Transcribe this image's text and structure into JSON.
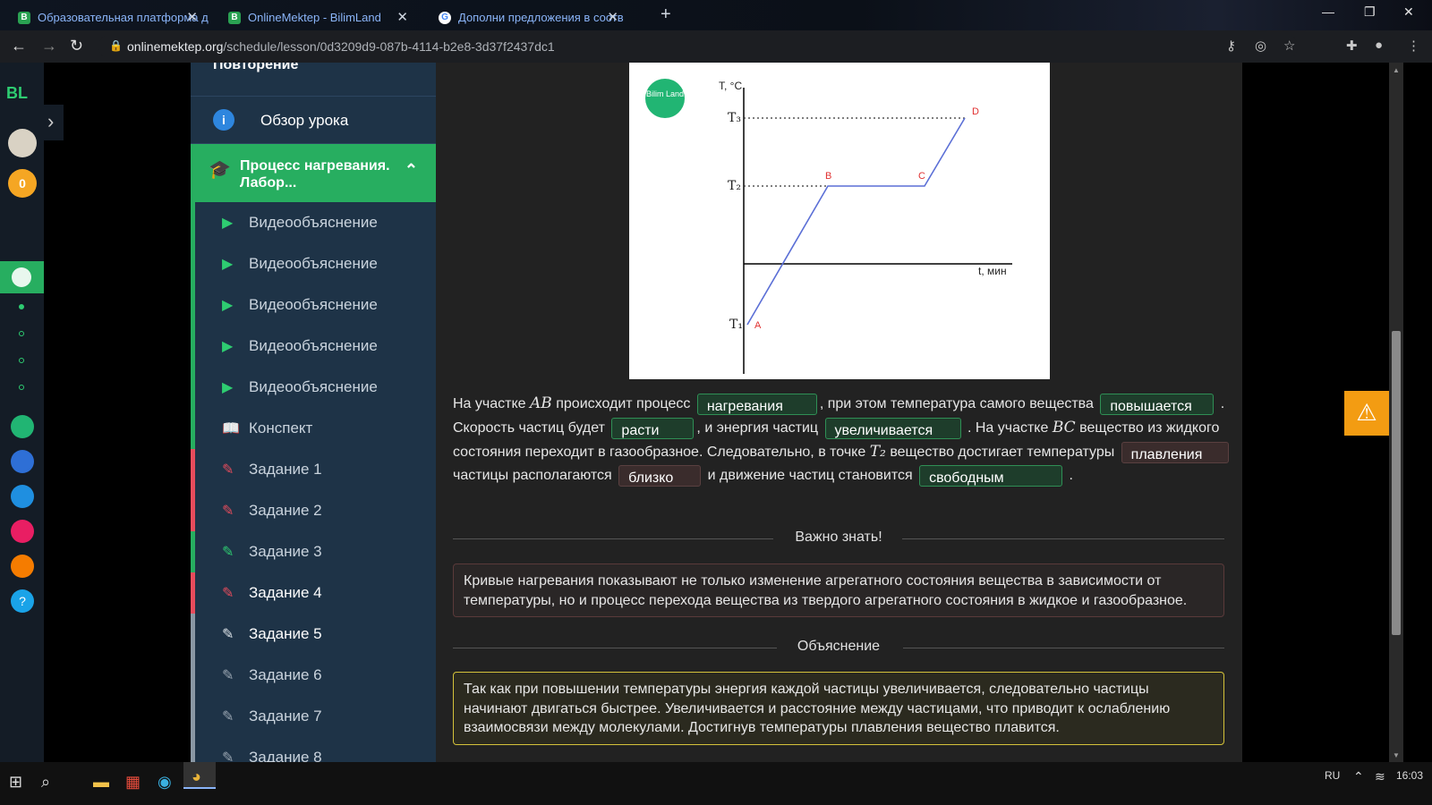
{
  "browser": {
    "tabs": [
      {
        "label": "Образовательная платформа д",
        "favicon": "B"
      },
      {
        "label": "OnlineMektep - BilimLand",
        "favicon": "B"
      },
      {
        "label": "Дополни предложения в соотв",
        "favicon": "G"
      }
    ],
    "address": {
      "host": "onlinemektep.org",
      "path": "/schedule/lesson/0d3209d9-087b-4114-b2e8-3d37f2437dc1"
    }
  },
  "leftbar": {
    "logo": "BL",
    "coins": "0"
  },
  "sidebar": {
    "section_title": "Повторение",
    "overview": "Обзор урока",
    "module_title": "Процесс нагревания. Лабор...",
    "items": [
      {
        "label": "Видеообъяснение",
        "icon": "play-icon"
      },
      {
        "label": "Видеообъяснение",
        "icon": "play-icon"
      },
      {
        "label": "Видеообъяснение",
        "icon": "play-icon"
      },
      {
        "label": "Видеообъяснение",
        "icon": "play-icon"
      },
      {
        "label": "Видеообъяснение",
        "icon": "play-icon"
      },
      {
        "label": "Конспект",
        "icon": "book-icon"
      },
      {
        "label": "Задание 1",
        "icon": "edit-icon"
      },
      {
        "label": "Задание 2",
        "icon": "edit-icon"
      },
      {
        "label": "Задание 3",
        "icon": "edit-icon"
      },
      {
        "label": "Задание 4",
        "icon": "edit-icon"
      },
      {
        "label": "Задание 5",
        "icon": "edit-icon"
      },
      {
        "label": "Задание 6",
        "icon": "edit-icon"
      },
      {
        "label": "Задание 7",
        "icon": "edit-icon"
      },
      {
        "label": "Задание 8",
        "icon": "edit-icon"
      }
    ]
  },
  "graph": {
    "badge": "Bilim Land",
    "y_axis_label": "T, °C",
    "x_axis_label": "t, мин",
    "t1": "T₁",
    "t2": "T₂",
    "t3": "T₃",
    "points": {
      "A": "A",
      "B": "B",
      "C": "C",
      "D": "D"
    }
  },
  "exercise": {
    "p1": "На участке",
    "ab": "AB",
    "p2": "происходит процесс",
    "b1": "нагревания",
    "p3": ", при этом температура самого вещества",
    "b2": "повышается",
    "p4": ". Скорость частиц будет",
    "b3": "расти",
    "p5": ", и энергия частиц",
    "b4": "увеличивается",
    "p6": ". На участке",
    "bc": "BC",
    "p7": "вещество из жидкого состояния переходит в газообразное. Следовательно, в точке",
    "t2": "T₂",
    "p8": "вещество достигает температуры",
    "b5": "плавления",
    "p9": "частицы располагаются",
    "b6": "близко",
    "p10": "и движение частиц становится",
    "b7": "свободным",
    "p11": "."
  },
  "important": {
    "title": "Важно знать!",
    "text": "Кривые нагревания показывают не только изменение агрегатного состояния вещества в зависимости от температуры, но и процесс перехода вещества из твердого агрегатного состояния в жидкое и газообразное."
  },
  "explanation": {
    "title": "Объяснение",
    "text": "Так как при повышении температуры энергия каждой частицы увеличивается, следовательно частицы начинают двигаться быстрее. Увеличивается и расстояние между частицами, что приводит к ослаблению взаимосвязи между молекулами. Достигнув температуры плавления вещество плавится."
  },
  "taskbar": {
    "lang": "RU",
    "time": "16:03"
  }
}
